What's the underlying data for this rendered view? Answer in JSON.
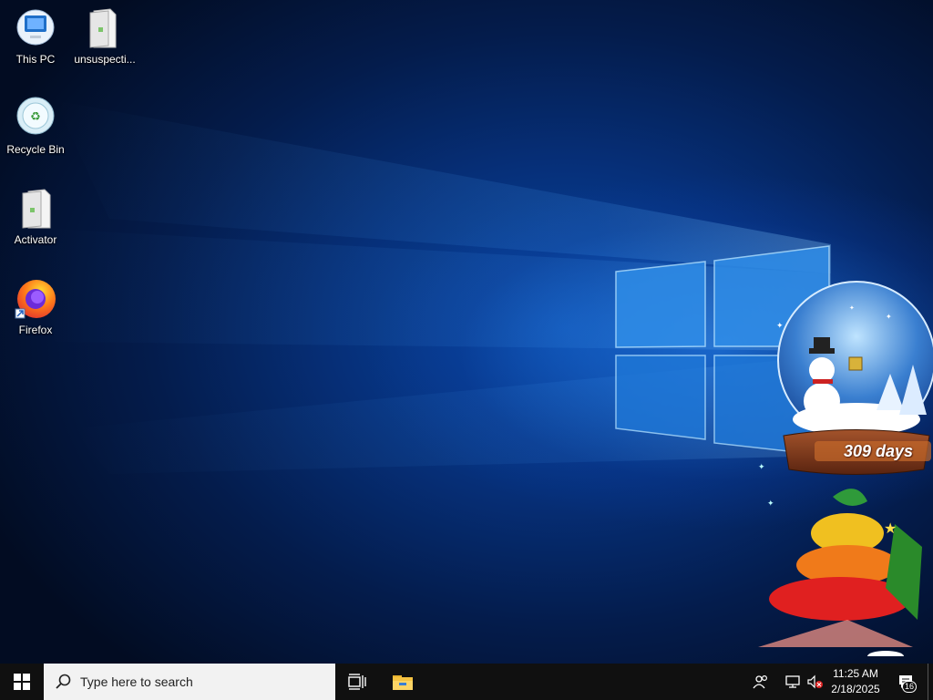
{
  "desktop": {
    "icons": [
      {
        "label": "This PC",
        "icon": "computer-icon"
      },
      {
        "label": "unsuspecti...",
        "icon": "file-icon"
      },
      {
        "label": "Recycle Bin",
        "icon": "recycle-bin-icon"
      },
      {
        "label": "Activator",
        "icon": "file-icon"
      },
      {
        "label": "Firefox",
        "icon": "firefox-icon"
      }
    ]
  },
  "widget": {
    "countdown_text": "309 days"
  },
  "taskbar": {
    "search_placeholder": "Type here to search",
    "clock_time": "11:25 AM",
    "clock_date": "2/18/2025",
    "notification_count": "16"
  },
  "colors": {
    "taskbar_bg": "#101010",
    "accent": "#0078d7"
  }
}
